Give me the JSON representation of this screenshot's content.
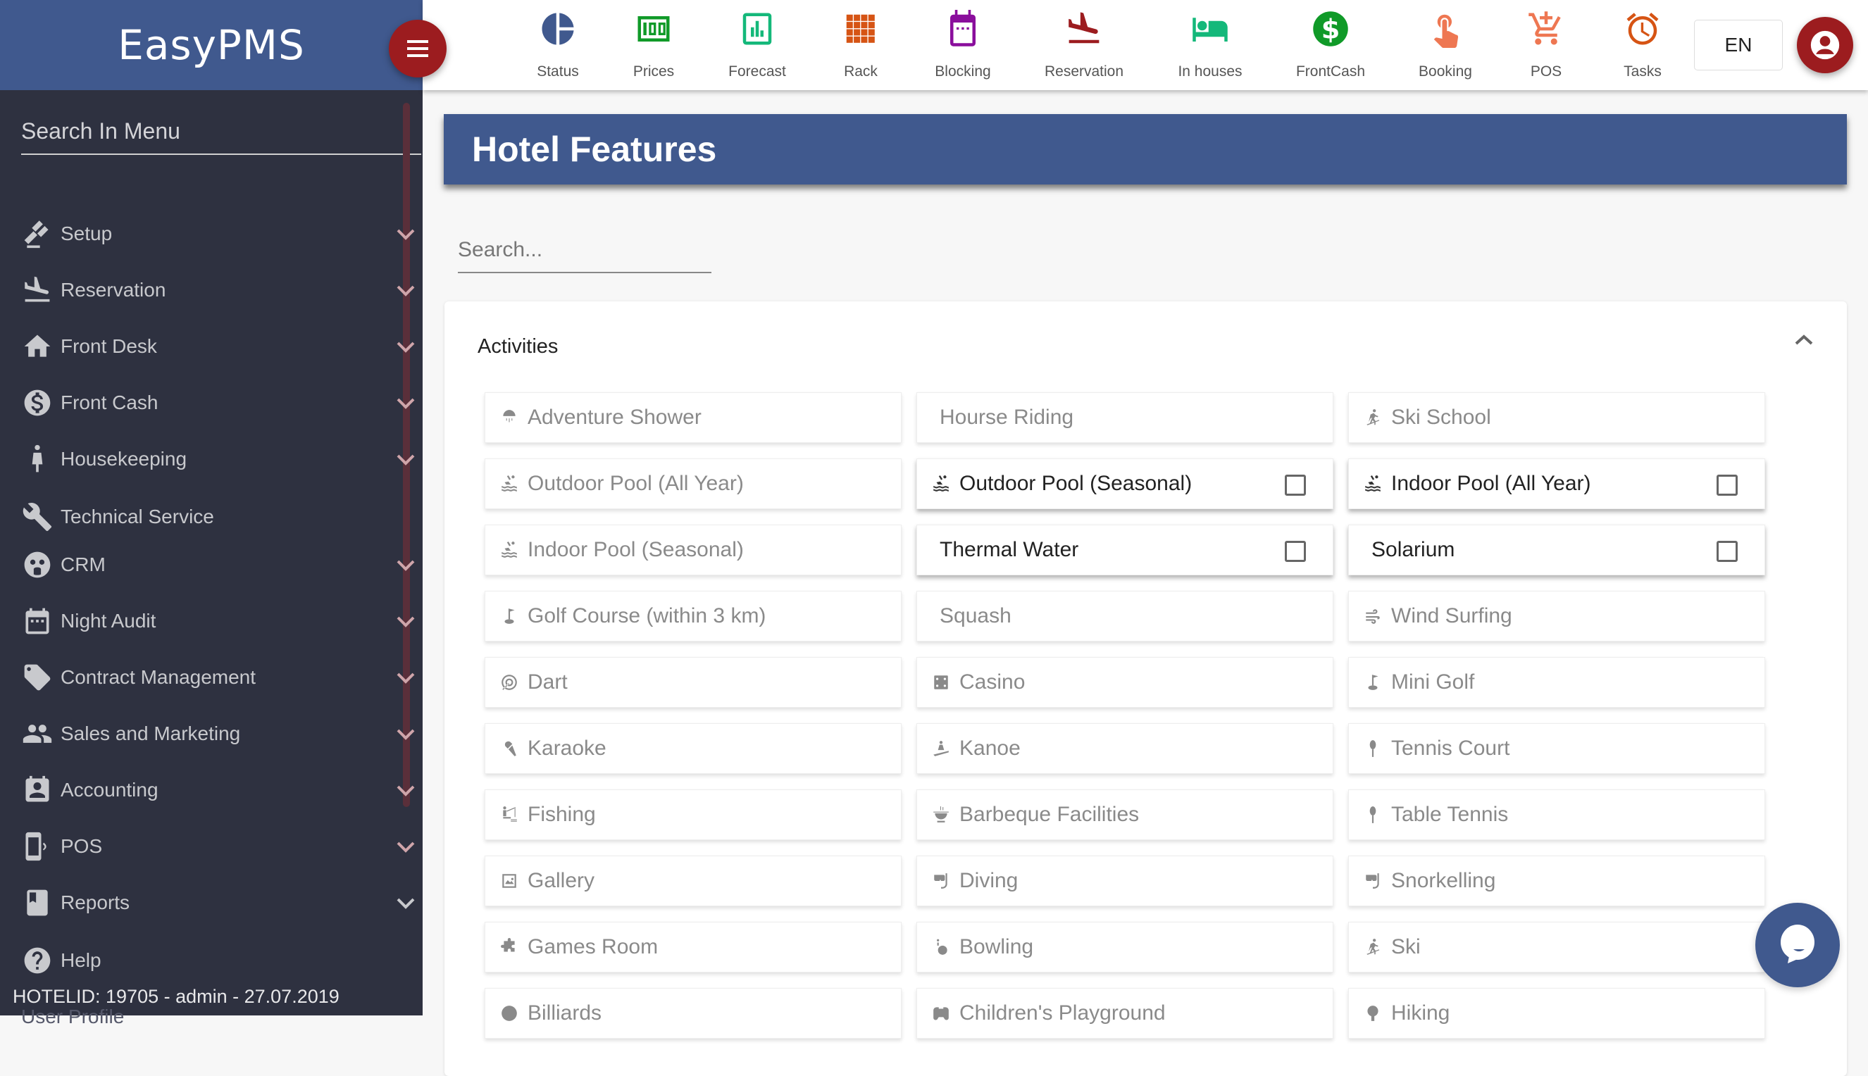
{
  "app": {
    "brand": "EasyPMS"
  },
  "sidebar": {
    "search_placeholder": "Search In Menu",
    "items": [
      {
        "label": "Setup",
        "icon": "gavel-icon",
        "expandable": true
      },
      {
        "label": "Reservation",
        "icon": "plane-landing-icon",
        "expandable": true
      },
      {
        "label": "Front Desk",
        "icon": "home-icon",
        "expandable": true
      },
      {
        "label": "Front Cash",
        "icon": "dollar-icon",
        "expandable": true
      },
      {
        "label": "Housekeeping",
        "icon": "housekeeper-icon",
        "expandable": true
      },
      {
        "label": "Technical Service",
        "icon": "wrench-icon",
        "expandable": false
      },
      {
        "label": "CRM",
        "icon": "crm-icon",
        "expandable": true
      },
      {
        "label": "Night Audit",
        "icon": "calendar-icon",
        "expandable": true
      },
      {
        "label": "Contract Management",
        "icon": "tag-icon",
        "expandable": true
      },
      {
        "label": "Sales and Marketing",
        "icon": "people-icon",
        "expandable": true
      },
      {
        "label": "Accounting",
        "icon": "contact-icon",
        "expandable": true
      },
      {
        "label": "POS",
        "icon": "pos-device-icon",
        "expandable": true
      },
      {
        "label": "Reports",
        "icon": "bookmark-icon",
        "expandable": true
      },
      {
        "label": "Help",
        "icon": "help-icon",
        "expandable": false
      }
    ],
    "footer": "HOTELID: 19705 - admin - 27.07.2019",
    "partial_item": "User Profile"
  },
  "topbar": {
    "items": [
      {
        "label": "Status",
        "icon": "pie-chart-icon",
        "color": "#40598e"
      },
      {
        "label": "Prices",
        "icon": "money-icon",
        "color": "#109a28"
      },
      {
        "label": "Forecast",
        "icon": "bar-chart-icon",
        "color": "#14b87a"
      },
      {
        "label": "Rack",
        "icon": "grid-icon",
        "color": "#d65414"
      },
      {
        "label": "Blocking",
        "icon": "calendar-icon",
        "color": "#8a0e9c"
      },
      {
        "label": "Reservation",
        "icon": "plane-landing-icon",
        "color": "#9c1c1f"
      },
      {
        "label": "In houses",
        "icon": "bed-icon",
        "color": "#14b87a"
      },
      {
        "label": "FrontCash",
        "icon": "dollar-icon",
        "color": "#109a28"
      },
      {
        "label": "Booking",
        "icon": "touch-icon",
        "color": "#ee7752"
      },
      {
        "label": "POS",
        "icon": "cart-icon",
        "color": "#ee7752"
      },
      {
        "label": "Tasks",
        "icon": "alarm-icon",
        "color": "#d65414"
      }
    ],
    "language": "EN"
  },
  "page": {
    "title": "Hotel Features",
    "search_placeholder": "Search...",
    "section": {
      "title": "Activities",
      "features": [
        {
          "label": "Adventure Shower",
          "icon": "shower-icon",
          "active": false
        },
        {
          "label": "Hourse Riding",
          "icon": "",
          "active": false
        },
        {
          "label": "Ski School",
          "icon": "ski-icon",
          "active": false
        },
        {
          "label": "Outdoor Pool (All Year)",
          "icon": "pool-icon",
          "active": false
        },
        {
          "label": "Outdoor Pool (Seasonal)",
          "icon": "pool-icon",
          "active": true,
          "checked": false
        },
        {
          "label": "Indoor Pool (All Year)",
          "icon": "pool-icon",
          "active": true,
          "checked": false
        },
        {
          "label": "Indoor Pool (Seasonal)",
          "icon": "pool-icon",
          "active": false
        },
        {
          "label": "Thermal Water",
          "icon": "",
          "active": true,
          "checked": false
        },
        {
          "label": "Solarium",
          "icon": "",
          "active": true,
          "checked": false
        },
        {
          "label": "Golf Course (within 3 km)",
          "icon": "golf-icon",
          "active": false
        },
        {
          "label": "Squash",
          "icon": "",
          "active": false
        },
        {
          "label": "Wind Surfing",
          "icon": "wind-icon",
          "active": false
        },
        {
          "label": "Dart",
          "icon": "target-icon",
          "active": false
        },
        {
          "label": "Casino",
          "icon": "dice-icon",
          "active": false
        },
        {
          "label": "Mini Golf",
          "icon": "golf-icon",
          "active": false
        },
        {
          "label": "Karaoke",
          "icon": "microphone-icon",
          "active": false
        },
        {
          "label": "Kanoe",
          "icon": "kayak-icon",
          "active": false
        },
        {
          "label": "Tennis Court",
          "icon": "racket-icon",
          "active": false
        },
        {
          "label": "Fishing",
          "icon": "fishing-icon",
          "active": false
        },
        {
          "label": "Barbeque Facilities",
          "icon": "bbq-icon",
          "active": false
        },
        {
          "label": "Table Tennis",
          "icon": "racket-icon",
          "active": false
        },
        {
          "label": "Gallery",
          "icon": "picture-icon",
          "active": false
        },
        {
          "label": "Diving",
          "icon": "snorkel-icon",
          "active": false
        },
        {
          "label": "Snorkelling",
          "icon": "snorkel-icon",
          "active": false
        },
        {
          "label": "Games Room",
          "icon": "puzzle-icon",
          "active": false
        },
        {
          "label": "Bowling",
          "icon": "bowling-icon",
          "active": false
        },
        {
          "label": "Ski",
          "icon": "ski-icon",
          "active": false
        },
        {
          "label": "Billiards",
          "icon": "billiard-ball-icon",
          "active": false
        },
        {
          "label": "Children's Playground",
          "icon": "gamepad-icon",
          "active": false
        },
        {
          "label": "Hiking",
          "icon": "tree-icon",
          "active": false
        }
      ]
    }
  },
  "chat": {
    "icon": "chat-icon"
  }
}
